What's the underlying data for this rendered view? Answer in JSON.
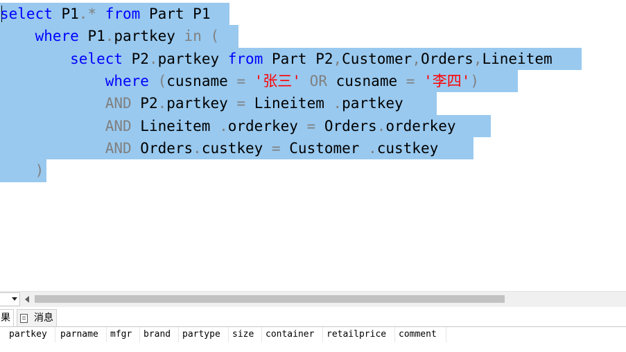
{
  "editor": {
    "l1": {
      "kw1": "select",
      "t1": " P1",
      "g1": ".*",
      "t2": " ",
      "kw2": "from",
      "t3": " Part P1"
    },
    "l2": {
      "ind": "    ",
      "kw1": "where",
      "t1": " P1",
      "g1": ".",
      "t2": "partkey ",
      "g2": "in (",
      "t3": ""
    },
    "l3": {
      "ind": "        ",
      "kw1": "select",
      "t1": " P2",
      "g1": ".",
      "t2": "partkey ",
      "kw2": "from",
      "t3": " Part P2",
      "g2": ",",
      "t4": "Customer",
      "g3": ",",
      "t5": "Orders",
      "g4": ",",
      "t6": "Lineitem"
    },
    "l4": {
      "ind": "            ",
      "kw1": "where",
      "t1": " ",
      "g1": "(",
      "t2": "cusname ",
      "g2": "=",
      "t3": " ",
      "s1": "'张三'",
      "t4": " ",
      "g3": "OR",
      "t5": " cusname ",
      "g4": "=",
      "t6": " ",
      "s2": "'李四'",
      "g5": ")"
    },
    "l5": {
      "ind": "            ",
      "g1": "AND",
      "t1": " P2",
      "g2": ".",
      "t2": "partkey ",
      "g3": "=",
      "t3": " Lineitem ",
      "g4": ".",
      "t4": "partkey"
    },
    "l6": {
      "ind": "            ",
      "g1": "AND",
      "t1": " Lineitem ",
      "g2": ".",
      "t2": "orderkey ",
      "g3": "=",
      "t3": " Orders",
      "g4": ".",
      "t4": "orderkey"
    },
    "l7": {
      "ind": "            ",
      "g1": "AND",
      "t1": " Orders",
      "g2": ".",
      "t2": "custkey ",
      "g3": "=",
      "t3": " Customer ",
      "g4": ".",
      "t4": "custkey"
    },
    "l8": {
      "ind": "    ",
      "g1": ")"
    }
  },
  "results_tabs": {
    "results": "果",
    "messages": "消息"
  },
  "columns": [
    "partkey",
    "parname",
    "mfgr",
    "brand",
    "partype",
    "size",
    "container",
    "retailprice",
    "comment"
  ],
  "icons": {
    "messages_tab": "document-icon",
    "zoom_dropdown": "chevron-down-icon",
    "scroll_left": "arrow-left-icon"
  },
  "colors": {
    "selection": "#99c9ef",
    "keyword": "#0000ff",
    "operator": "#808080",
    "string": "#ff0000"
  }
}
